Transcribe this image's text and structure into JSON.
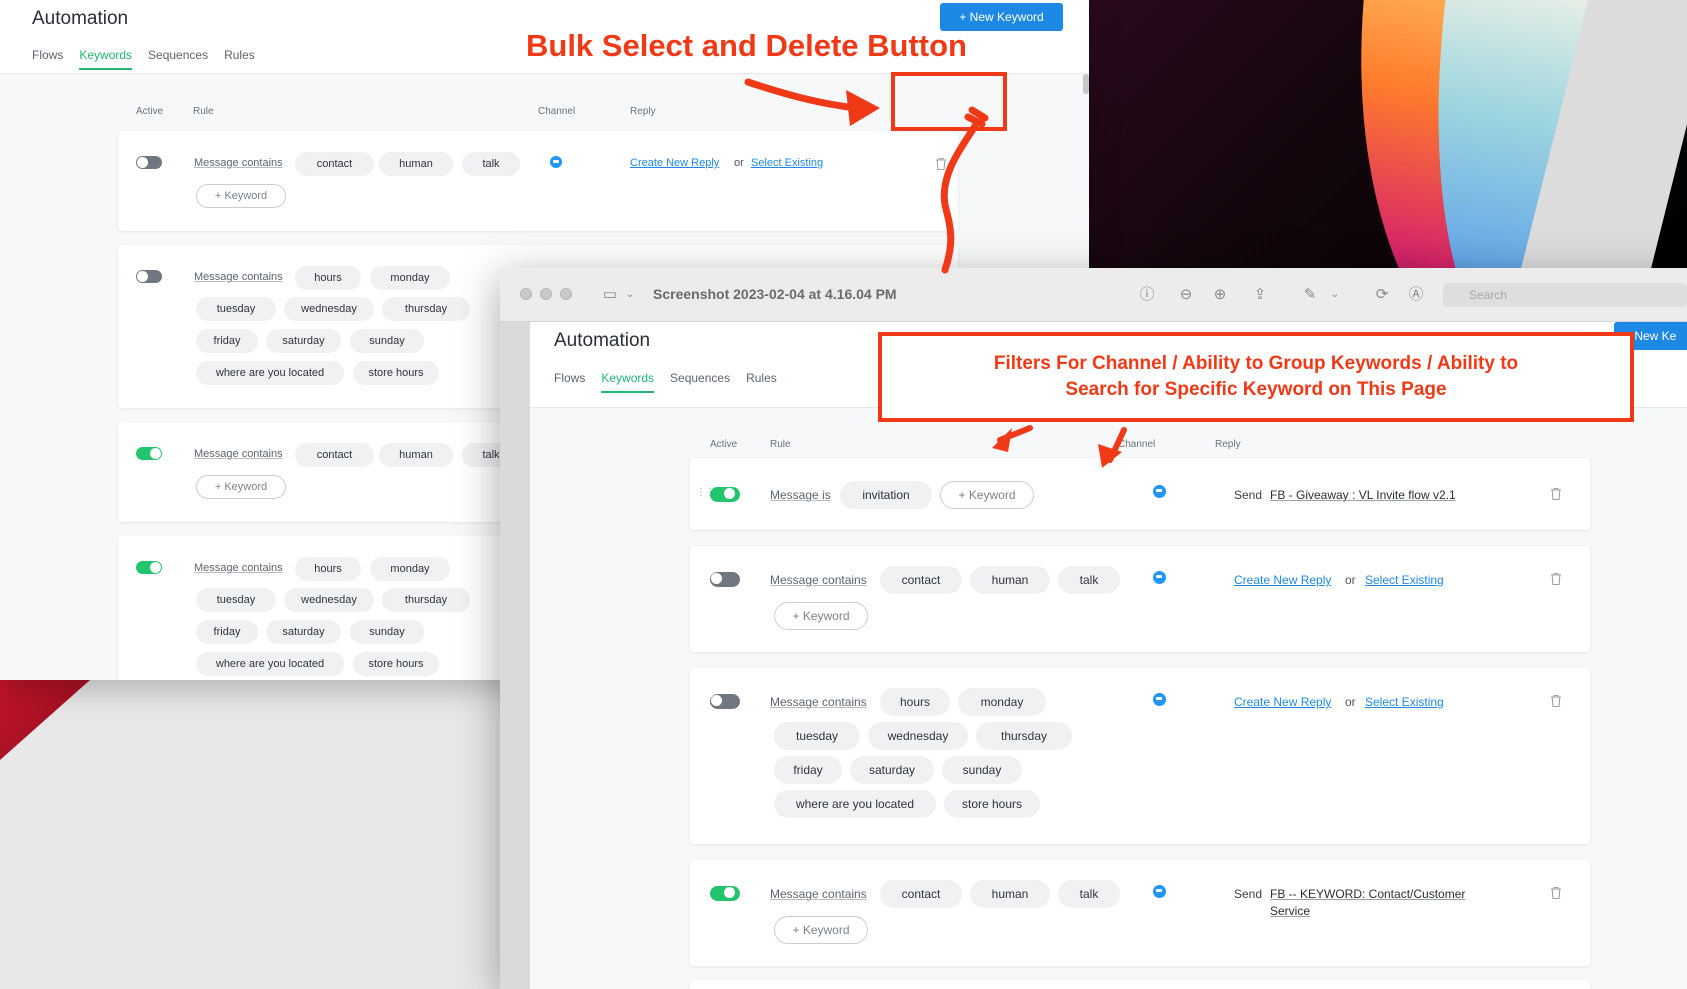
{
  "annotations": {
    "bulk_title": "Bulk Select and Delete Button",
    "filters_text_line1": "Filters For Channel / Ability to Group Keywords / Ability to",
    "filters_text_line2": "Search for Specific Keyword on This Page",
    "color": "#f03a17"
  },
  "back_window": {
    "title": "Automation",
    "tabs": [
      "Flows",
      "Keywords",
      "Sequences",
      "Rules"
    ],
    "active_tab": "Keywords",
    "new_keyword_button": "+ New Keyword",
    "columns": {
      "active": "Active",
      "rule": "Rule",
      "channel": "Channel",
      "reply": "Reply"
    },
    "add_keyword": "+ Keyword",
    "rules": [
      {
        "active": false,
        "rule": "Message contains",
        "keywords": [
          "contact",
          "human",
          "talk"
        ],
        "reply": {
          "create": "Create New Reply",
          "or": "or",
          "select": "Select Existing"
        }
      },
      {
        "active": false,
        "rule": "Message contains",
        "keywords": [
          "hours",
          "monday",
          "tuesday",
          "wednesday",
          "thursday",
          "friday",
          "saturday",
          "sunday",
          "where are you located",
          "store hours"
        ]
      },
      {
        "active": true,
        "rule": "Message contains",
        "keywords": [
          "contact",
          "human",
          "talk"
        ]
      },
      {
        "active": true,
        "rule": "Message contains",
        "keywords": [
          "hours",
          "monday",
          "tuesday",
          "wednesday",
          "thursday",
          "friday",
          "saturday",
          "sunday",
          "where are you located",
          "store hours"
        ]
      }
    ]
  },
  "front_window": {
    "window_title": "Screenshot 2023-02-04 at 4.16.04 PM",
    "search_placeholder": "Search",
    "title": "Automation",
    "tabs": [
      "Flows",
      "Keywords",
      "Sequences",
      "Rules"
    ],
    "active_tab": "Keywords",
    "new_keyword_button_partial": "+ New Ke",
    "columns": {
      "active": "Active",
      "rule": "Rule",
      "channel": "Channel",
      "reply": "Reply"
    },
    "add_keyword": "+ Keyword",
    "rules": [
      {
        "active": true,
        "rule": "Message is",
        "keywords": [
          "invitation"
        ],
        "reply": {
          "send": "Send",
          "flow": "FB - Giveaway : VL Invite flow v2.1"
        }
      },
      {
        "active": false,
        "rule": "Message contains",
        "keywords": [
          "contact",
          "human",
          "talk"
        ],
        "reply": {
          "create": "Create New Reply",
          "or": "or",
          "select": "Select Existing"
        }
      },
      {
        "active": false,
        "rule": "Message contains",
        "keywords": [
          "hours",
          "monday",
          "tuesday",
          "wednesday",
          "thursday",
          "friday",
          "saturday",
          "sunday",
          "where are you located",
          "store hours"
        ],
        "reply": {
          "create": "Create New Reply",
          "or": "or",
          "select": "Select Existing"
        }
      },
      {
        "active": true,
        "rule": "Message contains",
        "keywords": [
          "contact",
          "human",
          "talk"
        ],
        "reply": {
          "send": "Send",
          "flow_line1": "FB -- KEYWORD: Contact/Customer",
          "flow_line2": "Service"
        }
      }
    ]
  },
  "colors": {
    "accent_green": "#22b573",
    "toggle_on": "#22c56c",
    "link_blue": "#1e88e5",
    "button_blue": "#1e88e5"
  },
  "icons": [
    "trash-icon",
    "channel-messenger-icon",
    "sidebar-toggle-icon",
    "info-icon",
    "zoom-out-icon",
    "zoom-in-icon",
    "share-icon",
    "markup-icon",
    "rotate-icon",
    "annotate-icon",
    "search-icon",
    "drag-handle-icon"
  ]
}
